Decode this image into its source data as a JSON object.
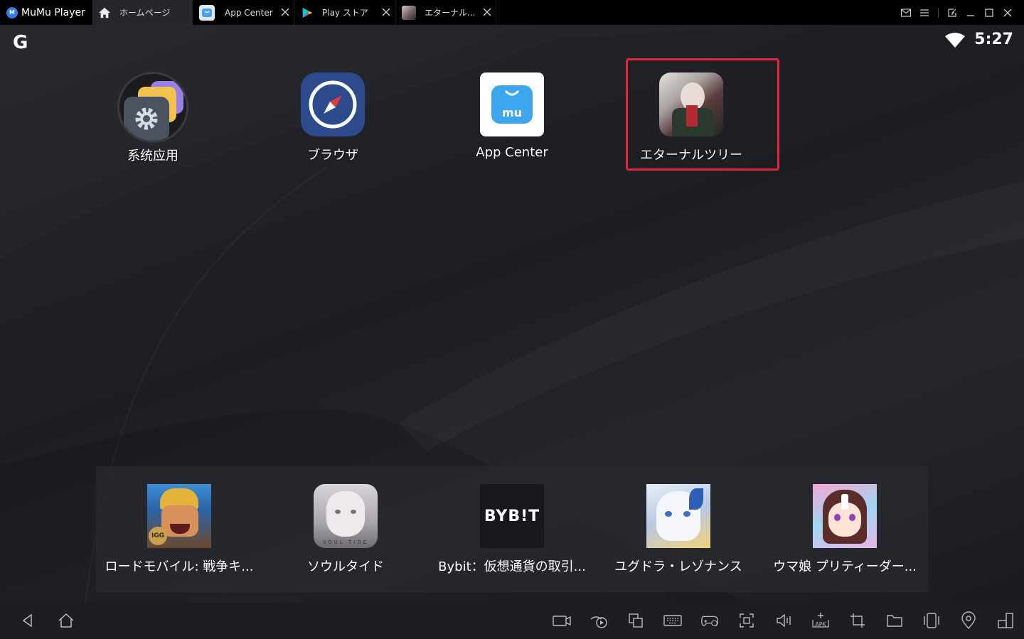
{
  "titlebar": {
    "app_name": "MuMu Player",
    "tabs": [
      {
        "label": "ホームページ",
        "icon": "home-icon",
        "active": true
      },
      {
        "label": "App Center",
        "icon": "app-center-icon",
        "active": false
      },
      {
        "label": "Play ストア",
        "icon": "play-store-icon",
        "active": false
      },
      {
        "label": "エターナル...",
        "icon": "eternal-tree-icon",
        "active": false
      }
    ]
  },
  "status": {
    "launcher_letter": "G",
    "time": "5:27"
  },
  "desktop_apps": [
    {
      "label": "系统应用",
      "icon": "system-apps-folder-icon"
    },
    {
      "label": "ブラウザ",
      "icon": "browser-compass-icon"
    },
    {
      "label": "App Center",
      "icon": "app-center-icon"
    },
    {
      "label": "エターナルツリー",
      "icon": "eternal-tree-game-icon"
    }
  ],
  "dock_apps": [
    {
      "label": "ロードモバイル: 戦争キ...",
      "icon": "lords-mobile-icon"
    },
    {
      "label": "ソウルタイド",
      "icon": "soul-tide-icon"
    },
    {
      "label": "Bybit：仮想通貨の取引...",
      "icon": "bybit-icon",
      "logo_text": "BYB!T"
    },
    {
      "label": "ユグドラ・レゾナンス",
      "icon": "yggdra-resonance-icon"
    },
    {
      "label": "ウマ娘 プリティーダー...",
      "icon": "umamusume-icon"
    }
  ],
  "colors": {
    "highlight": "#e0283c",
    "brand_blue": "#2e7de9",
    "background": "#1b1c20"
  }
}
